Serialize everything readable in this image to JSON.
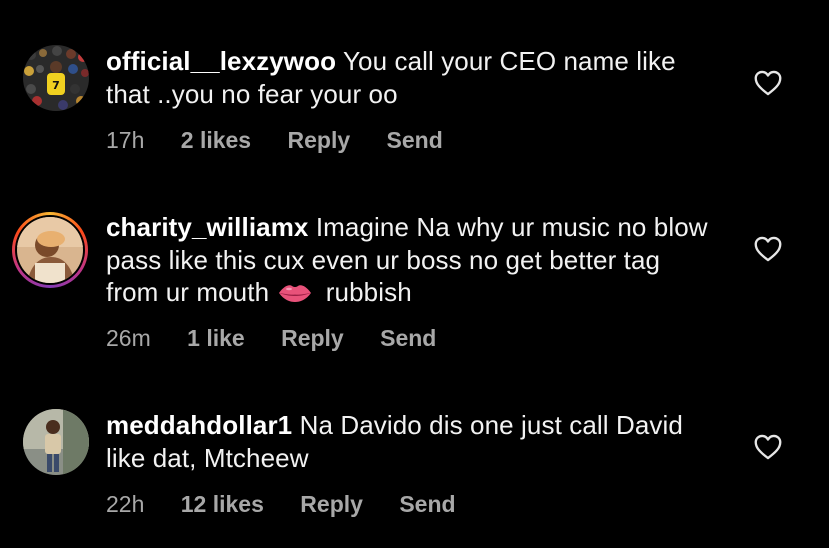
{
  "comments": [
    {
      "username": "official__lexzywoo",
      "text": "You call your CEO name like that ..you no fear your oo",
      "time": "17h",
      "likes": "2 likes",
      "reply": "Reply",
      "send": "Send"
    },
    {
      "username": "charity_williamx",
      "text_before_emoji": "Imagine Na why ur music no blow pass like this cux even ur boss no get better tag from ur mouth",
      "emoji": "lips-icon",
      "text_after_emoji": "rubbish",
      "time": "26m",
      "likes": "1 like",
      "reply": "Reply",
      "send": "Send"
    },
    {
      "username": "meddahdollar1",
      "text": "Na Davido dis one just call David like dat, Mtcheew",
      "time": "22h",
      "likes": "12 likes",
      "reply": "Reply",
      "send": "Send"
    }
  ],
  "colors": {
    "background": "#000000",
    "text": "#f2f2f2",
    "meta": "#a8a8a8",
    "story_ring_start": "#f7b733",
    "story_ring_end": "#833ab4"
  }
}
